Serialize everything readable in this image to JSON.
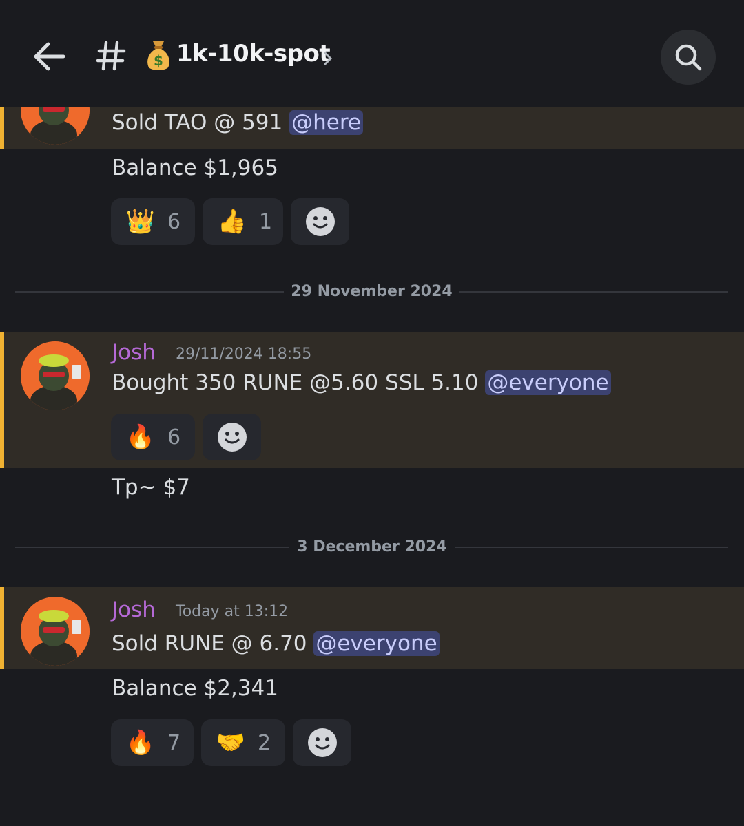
{
  "header": {
    "channel_emoji": "money-bag-icon",
    "channel_name": "1k-10k-spot"
  },
  "messages": [
    {
      "text": "Sold TAO @ 591 ",
      "mention": "@here",
      "followup": "Balance $1,965",
      "reactions": [
        {
          "emoji": "👑",
          "count": "6"
        },
        {
          "emoji": "👍",
          "count": "1"
        }
      ]
    },
    {
      "author": "Josh",
      "timestamp": "29/11/2024 18:55",
      "text": "Bought 350 RUNE @5.60 SSL 5.10 ",
      "mention": "@everyone",
      "reactions": [
        {
          "emoji": "🔥",
          "count": "6"
        }
      ],
      "followup": "Tp~ $7"
    },
    {
      "author": "Josh",
      "timestamp": "Today at 13:12",
      "text": "Sold RUNE @ 6.70 ",
      "mention": "@everyone",
      "followup": "Balance $2,341",
      "reactions": [
        {
          "emoji": "🔥",
          "count": "7"
        },
        {
          "emoji": "🤝",
          "count": "2"
        }
      ]
    }
  ],
  "dividers": [
    "29 November 2024",
    "3 December 2024"
  ],
  "colors": {
    "background": "#1a1b1f",
    "highlight": "#302c26",
    "highlight_bar": "#f0b232",
    "username": "#b569d6",
    "mention_bg": "#3c4270",
    "mention_text": "#c9cdfb"
  }
}
